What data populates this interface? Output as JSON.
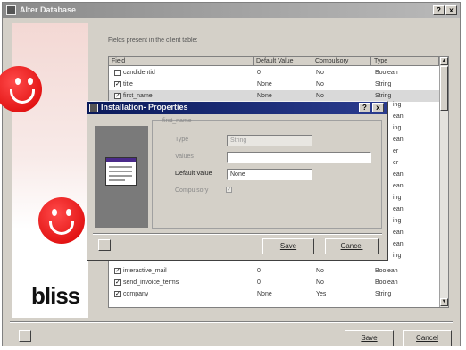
{
  "outer_window": {
    "title": "Alter Database",
    "help_button": "?",
    "close_button": "x"
  },
  "logo": {
    "text": "bliss"
  },
  "main": {
    "fields_label": "Fields present in the client table:",
    "columns": [
      "Field",
      "Default Value",
      "Compulsory",
      "Type"
    ],
    "rows": [
      {
        "checked": false,
        "field": "candidentid",
        "default": "0",
        "compulsory": "No",
        "type": "Boolean"
      },
      {
        "checked": true,
        "field": "title",
        "default": "None",
        "compulsory": "No",
        "type": "String"
      },
      {
        "checked": true,
        "field": "first_name",
        "default": "None",
        "compulsory": "No",
        "type": "String"
      }
    ],
    "bottom_rows": [
      {
        "checked": true,
        "field": "interactive_mail",
        "default": "0",
        "compulsory": "No",
        "type": "Boolean"
      },
      {
        "checked": true,
        "field": "send_invoice_terms",
        "default": "0",
        "compulsory": "No",
        "type": "Boolean"
      },
      {
        "checked": true,
        "field": "company",
        "default": "None",
        "compulsory": "Yes",
        "type": "String"
      }
    ],
    "hidden_type_fragments": [
      "ing",
      "ean",
      "ing",
      "ean",
      "er",
      "er",
      "ean",
      "ean",
      "ing",
      "ean",
      "ing",
      "ean",
      "ean",
      "ing"
    ],
    "save_label": "Save",
    "cancel_label": "Cancel"
  },
  "dialog": {
    "title": "Installation- Properties",
    "help_button": "?",
    "close_button": "x",
    "field_name": "first_name",
    "type_label": "Type",
    "type_value": "String",
    "values_label": "Values",
    "values_value": "",
    "default_label": "Default Value",
    "default_value": "None",
    "compulsory_label": "Compulsory",
    "save_label": "Save",
    "cancel_label": "Cancel"
  },
  "colors": {
    "dialog_title": "#0a1a5a",
    "face_red": "#d80000",
    "window_gray": "#d4d0c8"
  }
}
